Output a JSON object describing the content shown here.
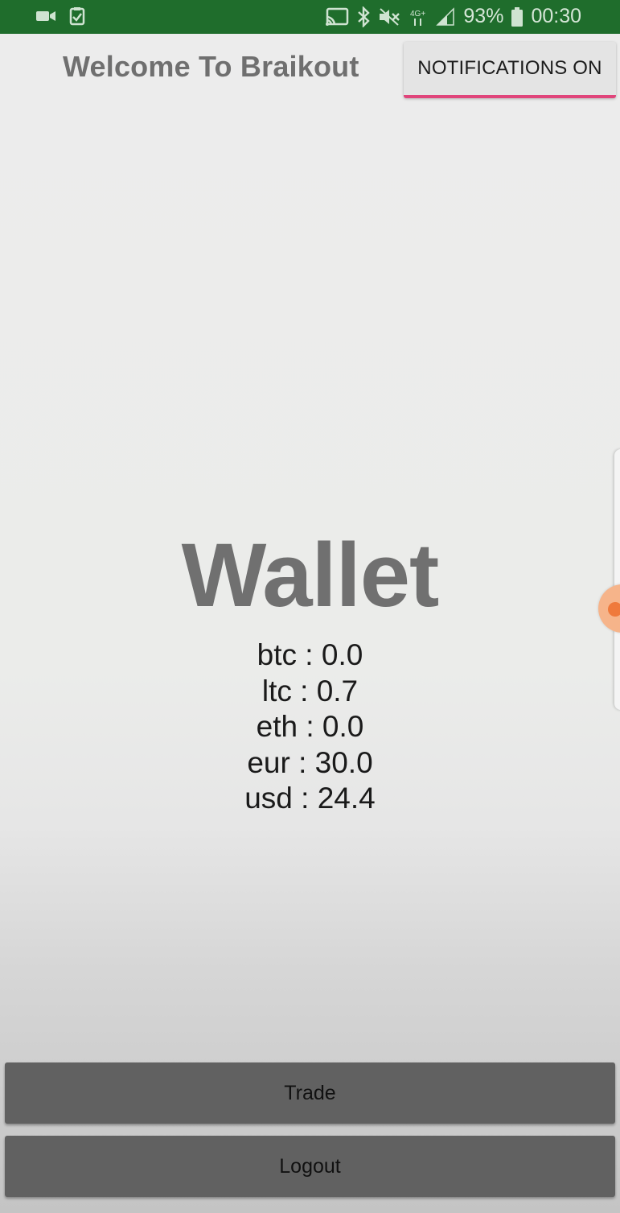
{
  "status_bar": {
    "battery": "93%",
    "time": "00:30",
    "network": "4G+",
    "icons": [
      "video-icon",
      "clipboard-check-icon",
      "cast-icon",
      "bluetooth-icon",
      "mute-icon",
      "signal-icon",
      "battery-icon"
    ]
  },
  "header": {
    "welcome_text": "Welcome To Braikout",
    "notifications_button": "NOTIFICATIONS ON"
  },
  "wallet": {
    "title": "Wallet",
    "balances": [
      {
        "text": "btc : 0.0"
      },
      {
        "text": "ltc : 0.7"
      },
      {
        "text": "eth : 0.0"
      },
      {
        "text": "eur : 30.0"
      },
      {
        "text": "usd : 24.4"
      }
    ]
  },
  "buttons": {
    "trade": "Trade",
    "logout": "Logout"
  },
  "colors": {
    "status_bar": "#1f6d2c",
    "toggle_accent": "#e0457b",
    "button_bg": "#616161"
  }
}
